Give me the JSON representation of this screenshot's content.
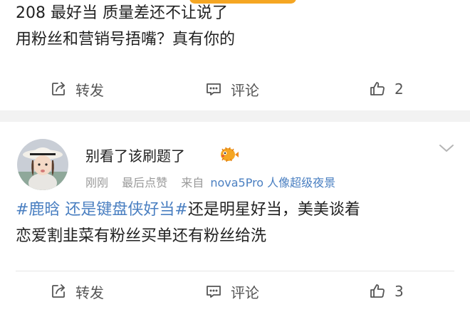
{
  "posts": [
    {
      "lines": [
        "208 最好当 质量差还不让说了",
        "用粉丝和营销号捂嘴？真有你的"
      ],
      "actions": {
        "repost": "转发",
        "comment": "评论",
        "likes": "2"
      }
    },
    {
      "user": {
        "name": "别看了该刷题了"
      },
      "meta": {
        "time": "刚刚",
        "likes_note": "最后点赞",
        "source_label": "来自",
        "source_device": "nova5Pro 人像超级夜景"
      },
      "line1": {
        "hashtag": "#鹿晗 还是键盘侠好当#",
        "rest": "还是明星好当，美美谈着"
      },
      "line2": "恋爱割韭菜有粉丝买单还有粉丝给洗",
      "actions": {
        "repost": "转发",
        "comment": "评论",
        "likes": "3"
      }
    }
  ],
  "icons": [
    "repost-icon",
    "comment-icon",
    "like-icon",
    "chevron-down-icon",
    "pufferfish-emoji-icon"
  ],
  "colors": {
    "link": "#4a7fc1",
    "text": "#222222",
    "meta": "#999999",
    "separator": "#f2f2f2"
  }
}
